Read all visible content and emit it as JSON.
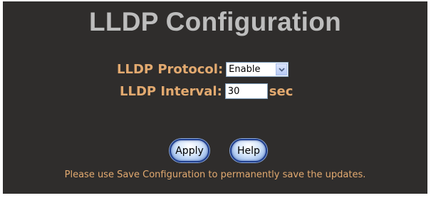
{
  "page": {
    "title": "LLDP Configuration"
  },
  "form": {
    "protocol_label": "LLDP Protocol:",
    "protocol_value": "Enable",
    "interval_label": "LLDP Interval:",
    "interval_value": "30",
    "interval_unit": "sec"
  },
  "buttons": {
    "apply_label": "Apply",
    "help_label": "Help"
  },
  "footer": {
    "note": "Please use Save Configuration to permanently save the updates."
  },
  "colors": {
    "background": "#2f2d2c",
    "title": "#bdbdbd",
    "label": "#e3aa70"
  }
}
